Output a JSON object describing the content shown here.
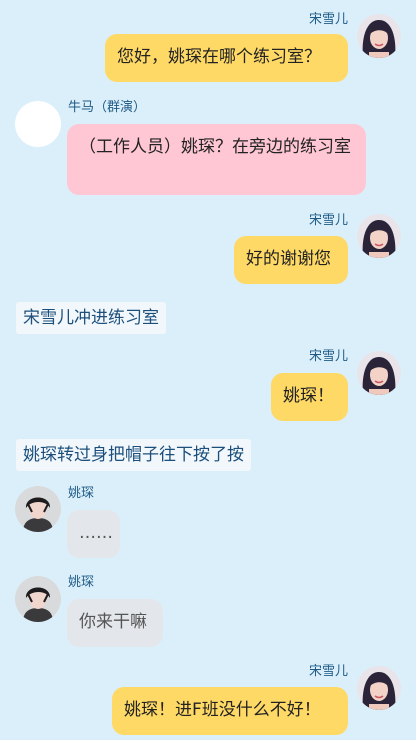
{
  "messages": [
    {
      "speaker": "宋雪儿",
      "text": "您好，姚琛在哪个练习室？"
    },
    {
      "speaker": "牛马（群演）",
      "text": "（工作人员）姚琛？在旁边的练习室"
    },
    {
      "speaker": "宋雪儿",
      "text": "好的谢谢您"
    },
    {
      "narration": "宋雪儿冲进练习室"
    },
    {
      "speaker": "宋雪儿",
      "text": "姚琛！"
    },
    {
      "narration": "姚琛转过身把帽子往下按了按"
    },
    {
      "speaker": "姚琛",
      "text": "……"
    },
    {
      "speaker": "姚琛",
      "text": "你来干嘛"
    },
    {
      "speaker": "宋雪儿",
      "text": "姚琛！进F班没什么不好！"
    }
  ]
}
